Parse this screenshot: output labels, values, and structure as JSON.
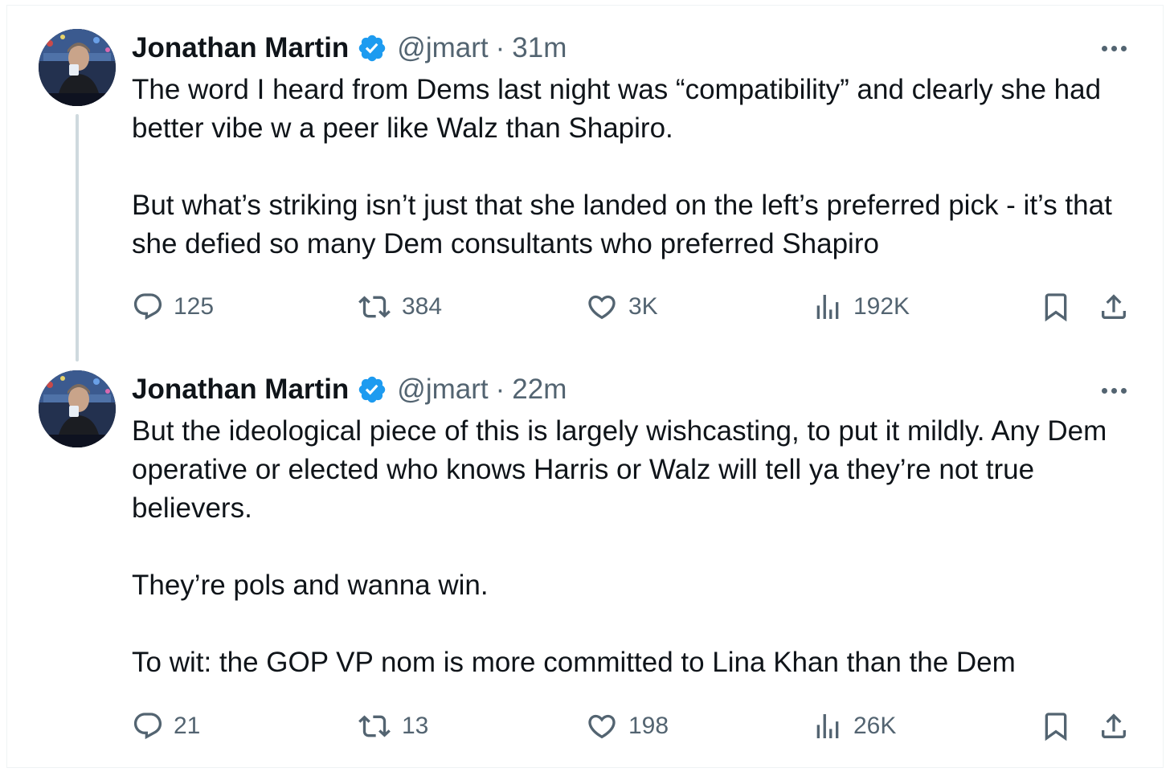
{
  "colors": {
    "text": "#0f1419",
    "secondary": "#536471",
    "verified": "#1d9bf0",
    "thread_line": "#cfd9de"
  },
  "tweets": [
    {
      "author_name": "Jonathan Martin",
      "handle": "@jmart",
      "separator": "·",
      "time": "31m",
      "paragraphs": [
        "The word I heard from Dems last night was “compatibility” and clearly she had better vibe w a peer like Walz than Shapiro.",
        "But what’s striking isn’t just that she landed on the left’s preferred pick - it’s that she defied so many Dem consultants who preferred Shapiro"
      ],
      "replies": "125",
      "reposts": "384",
      "likes": "3K",
      "views": "192K"
    },
    {
      "author_name": "Jonathan Martin",
      "handle": "@jmart",
      "separator": "·",
      "time": "22m",
      "paragraphs": [
        "But the ideological piece of this is largely wishcasting, to put it mildly.  Any Dem operative or elected who knows Harris or Walz will tell ya they’re not true believers.",
        "They’re pols and wanna win.",
        "To wit: the GOP VP nom is more committed to Lina Khan than the Dem"
      ],
      "replies": "21",
      "reposts": "13",
      "likes": "198",
      "views": "26K"
    }
  ],
  "icons": {
    "verified": "verified-badge-icon",
    "more": "more-options-icon",
    "reply": "reply-icon",
    "repost": "repost-icon",
    "like": "heart-icon",
    "views": "views-icon",
    "bookmark": "bookmark-icon",
    "share": "share-icon"
  }
}
